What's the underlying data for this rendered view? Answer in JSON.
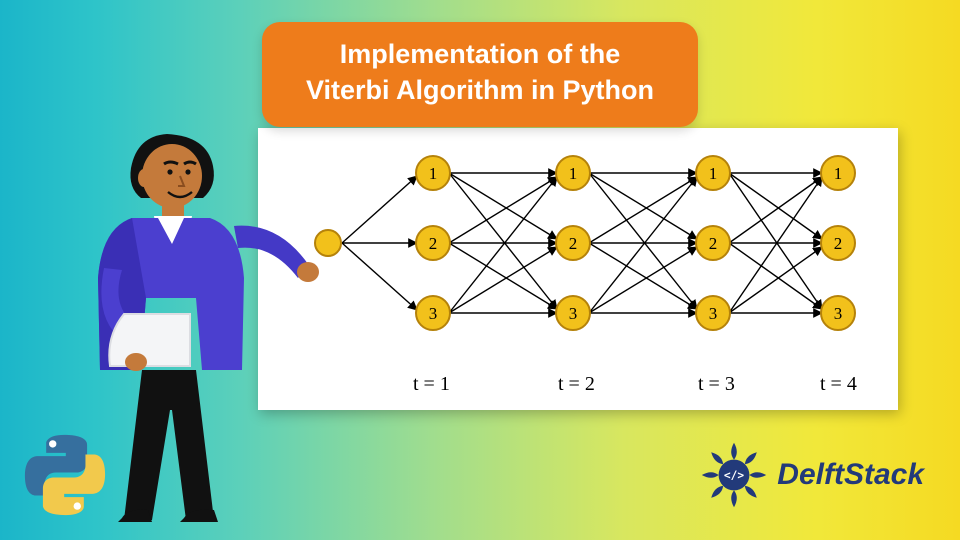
{
  "title_line1": "Implementation of the",
  "title_line2": "Viterbi Algorithm in Python",
  "brand": "DelftStack",
  "chart_data": {
    "type": "trellis-diagram",
    "start_node": true,
    "time_steps": [
      "t = 1",
      "t = 2",
      "t = 3",
      "t = 4"
    ],
    "states_per_step": [
      1,
      2,
      3
    ],
    "transitions": "fully-connected between adjacent columns"
  }
}
